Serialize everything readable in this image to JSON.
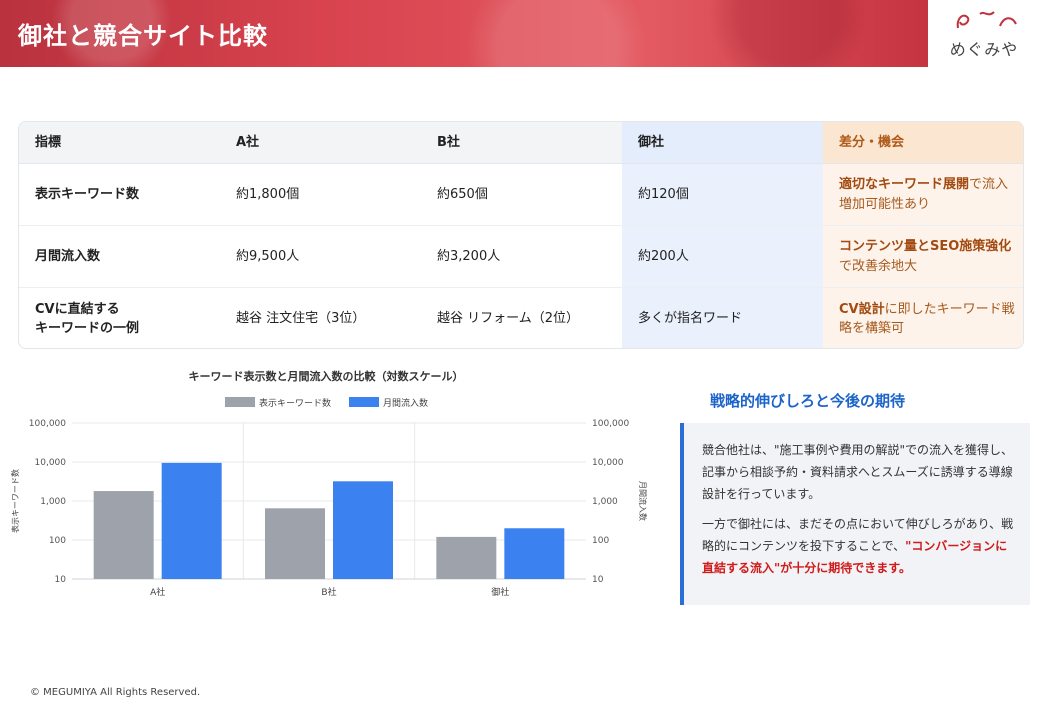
{
  "header": {
    "title": "御社と競合サイト比較"
  },
  "logo": {
    "text": "めぐみや"
  },
  "table": {
    "columns": [
      "指標",
      "A社",
      "B社",
      "御社",
      "差分・機会"
    ],
    "rows": [
      {
        "metric": "表示キーワード数",
        "a": "約1,800個",
        "b": "約650個",
        "own": "約120個",
        "gap_strong": "適切なキーワード展開",
        "gap_rest": "で流入増加可能性あり"
      },
      {
        "metric": "月間流入数",
        "a": "約9,500人",
        "b": "約3,200人",
        "own": "約200人",
        "gap_strong": "コンテンツ量とSEO施策強化",
        "gap_rest": "で改善余地大"
      },
      {
        "metric": "CVに直結する\nキーワードの一例",
        "a": "越谷 注文住宅（3位）",
        "b": "越谷 リフォーム（2位）",
        "own": "多くが指名ワード",
        "gap_strong": "CV設計",
        "gap_rest": "に即したキーワード戦略を構築可"
      }
    ]
  },
  "chart_data": {
    "type": "bar",
    "title": "キーワード表示数と月間流入数の比較（対数スケール）",
    "categories": [
      "A社",
      "B社",
      "御社"
    ],
    "series": [
      {
        "name": "表示キーワード数",
        "values": [
          1800,
          650,
          120
        ],
        "color": "#9ea3ab"
      },
      {
        "name": "月間流入数",
        "values": [
          9500,
          3200,
          200
        ],
        "color": "#3b82f0"
      }
    ],
    "yscale": "log",
    "ylim": [
      10,
      100000
    ],
    "yticks": [
      "100,000",
      "10,000",
      "1,000",
      "100",
      "10"
    ],
    "ylabel": "表示キーワード数",
    "y2label": "月間流入数",
    "legend": "top",
    "grid": true
  },
  "right": {
    "title": "戦略的伸びしろと今後の期待",
    "p1": "競合他社は、\"施工事例や費用の解説\"での流入を獲得し、記事から相談予約・資料請求へとスムーズに誘導する導線設計を行っています。",
    "p2_a": "一方で御社には、まだその点において伸びしろがあり、戦略的にコンテンツを投下することで、",
    "p2_hl": "\"コンバージョンに直結する流入\"が十分に期待できます。"
  },
  "footer": {
    "text": "© MEGUMIYA All Rights Reserved."
  }
}
